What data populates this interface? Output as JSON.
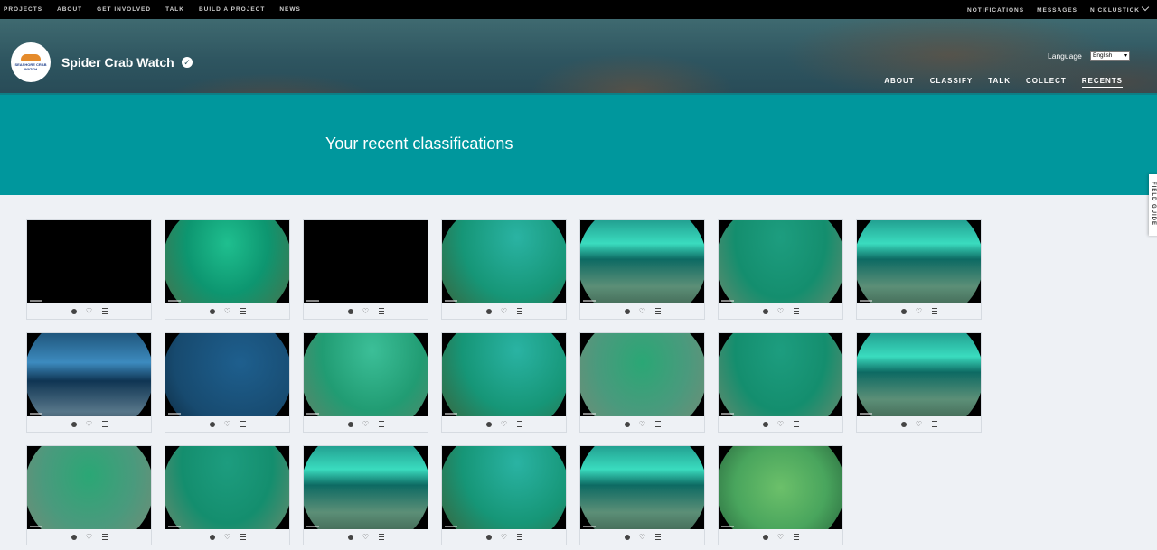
{
  "topnav": {
    "left": [
      "PROJECTS",
      "ABOUT",
      "GET INVOLVED",
      "TALK",
      "BUILD A PROJECT",
      "NEWS"
    ],
    "right": [
      "NOTIFICATIONS",
      "MESSAGES",
      "NICKLUSTICK"
    ]
  },
  "project": {
    "logo_text": "SEASHORE CRAB WATCH",
    "title": "Spider Crab Watch",
    "verified_icon": "checkmark-circle",
    "language_label": "Language",
    "language_value": "English",
    "nav": [
      "ABOUT",
      "CLASSIFY",
      "TALK",
      "COLLECT",
      "RECENTS"
    ],
    "active_nav": "RECENTS"
  },
  "hero": {
    "title": "Your recent classifications"
  },
  "field_guide": {
    "label": "FIELD GUIDE"
  },
  "colors": {
    "topbar": "#000000",
    "teal": "#00979d",
    "background": "#eef1f5"
  },
  "classifications": {
    "actions": [
      "info-icon",
      "heart-icon",
      "list-icon"
    ],
    "thumbnails": [
      [
        "dark",
        "g1",
        "dark",
        "g2",
        "g3",
        "g4",
        "g3"
      ],
      [
        "b1",
        "b2",
        "g5",
        "g2",
        "g6",
        "g4",
        "g3"
      ],
      [
        "g6",
        "g4",
        "g3",
        "g2",
        "g3",
        "g7"
      ]
    ]
  }
}
